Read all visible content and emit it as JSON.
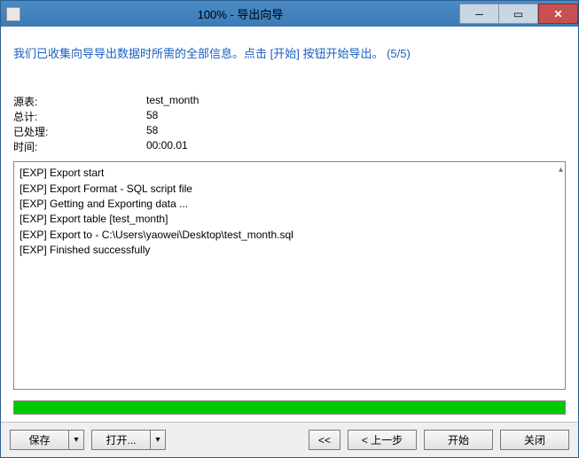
{
  "title": "100% - 导出向导",
  "instruction": {
    "text": "我们已收集向导导出数据时所需的全部信息。点击 [开始] 按钮开始导出。",
    "step": "(5/5)"
  },
  "info": {
    "source_table": {
      "label": "源表:",
      "value": "test_month"
    },
    "total": {
      "label": "总计:",
      "value": "58"
    },
    "processed": {
      "label": "已处理:",
      "value": "58"
    },
    "time": {
      "label": "时间:",
      "value": "00:00.01"
    }
  },
  "log_text": "[EXP] Export start\n[EXP] Export Format - SQL script file\n[EXP] Getting and Exporting data ...\n[EXP] Export table [test_month]\n[EXP] Export to - C:\\Users\\yaowei\\Desktop\\test_month.sql\n[EXP] Finished successfully",
  "progress_percent": 100,
  "buttons": {
    "save": "保存 ",
    "open": "打开... ",
    "first": "<<",
    "prev": "< 上一步",
    "start": "开始",
    "close": "关闭"
  },
  "arrow_glyph": "▾"
}
